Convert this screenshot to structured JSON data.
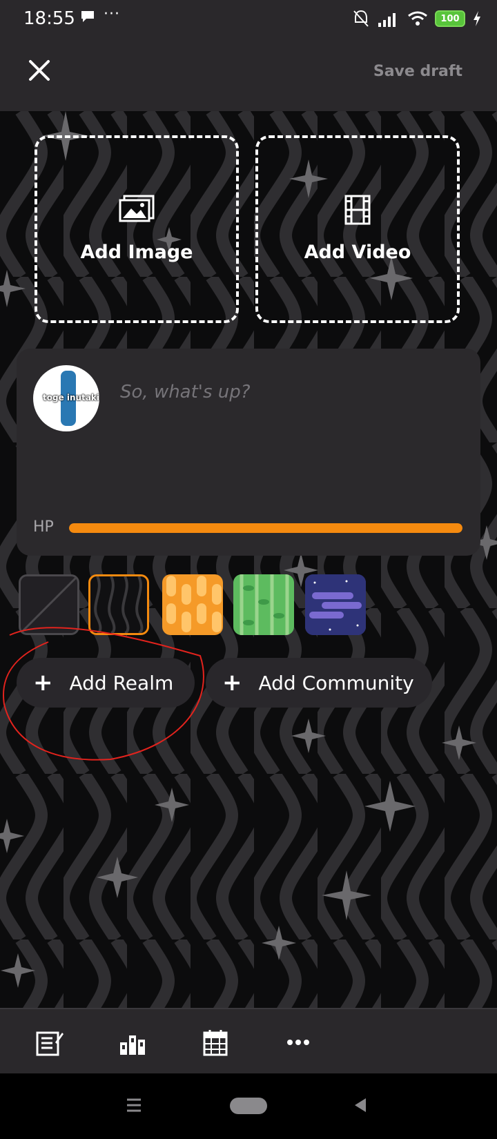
{
  "status_bar": {
    "time": "18:55",
    "more": "···",
    "battery": "100"
  },
  "header": {
    "save_draft": "Save draft"
  },
  "media": {
    "add_image": "Add Image",
    "add_video": "Add Video"
  },
  "composer": {
    "placeholder": "So, what's up?",
    "avatar_text": "toge inutaki",
    "hp_label": "HP",
    "hp_fraction": 1.0
  },
  "themes": [
    "none",
    "dark-waves",
    "orange-pills",
    "green-vines",
    "purple-space"
  ],
  "selected_theme": "dark-waves",
  "actions": {
    "add_realm": "Add Realm",
    "add_community": "Add Community",
    "plus": "+"
  },
  "bottom_tools": [
    "notes-icon",
    "ranking-icon",
    "calendar-icon",
    "more-icon"
  ],
  "colors": {
    "accent": "#f58a0f",
    "background": "#0c0c0d",
    "panel": "#2b292c"
  }
}
